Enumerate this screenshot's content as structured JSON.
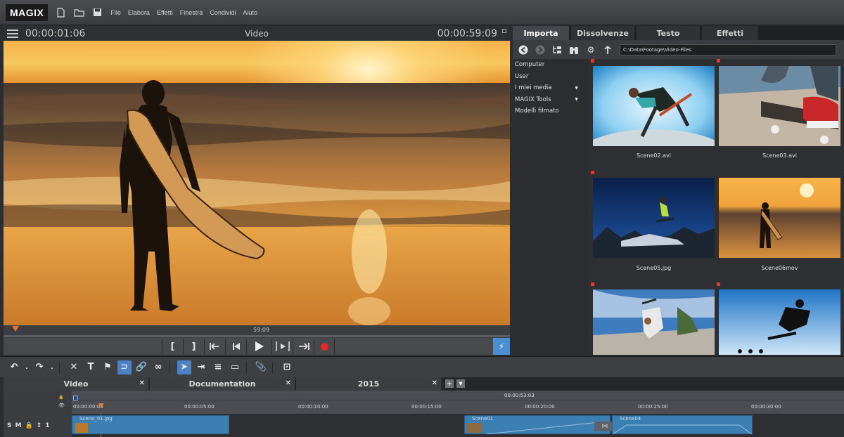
{
  "app": {
    "logo": "MAGIX"
  },
  "menu": {
    "items": [
      "File",
      "Elabora",
      "Effetti",
      "Finestra",
      "Condividi",
      "Aiuto"
    ]
  },
  "preview": {
    "timecode_left": "00:00:01:06",
    "title": "Video",
    "timecode_right": "00:00:59:09",
    "scrub_time": "59:09"
  },
  "media_pool": {
    "tabs": [
      "Importa",
      "Dissolvenze",
      "Testo",
      "Effetti"
    ],
    "active_tab": "Importa",
    "path": "C:\\Data\\Footage\\Video-Files",
    "tree": [
      {
        "label": "Computer",
        "expandable": false
      },
      {
        "label": "User",
        "expandable": false
      },
      {
        "label": "I miei media",
        "expandable": true
      },
      {
        "label": "MAGIX Tools",
        "expandable": true
      },
      {
        "label": "Modelli filmato",
        "expandable": false
      }
    ],
    "files": [
      "Scene02.avi",
      "Scene03.avi",
      "Scene05.jpg",
      "Scene06mov"
    ]
  },
  "timeline": {
    "tabs": [
      "Video",
      "Documentation",
      "2015"
    ],
    "current_time": "00:00:53:03",
    "ruler_labels": [
      "00:00:00:00",
      "00:00:05:00",
      "00:00:10:00",
      "00:00:15:00",
      "00:00:20:00",
      "00:00:25:00",
      "00:00:30:00"
    ],
    "track_controls": [
      "S",
      "M",
      "1"
    ],
    "clips": [
      "Scene_01.jpg",
      "Scene01",
      "Scene04"
    ]
  },
  "colors": {
    "accent_blue": "#4a8ed4",
    "record_red": "#e02a2a",
    "playhead_orange": "#e8732c"
  }
}
